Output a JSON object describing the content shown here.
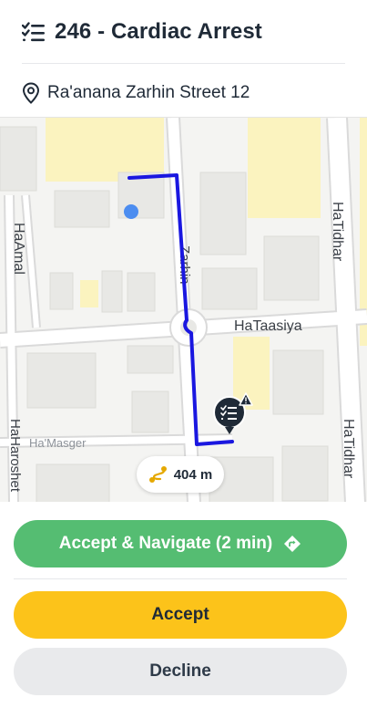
{
  "incident": {
    "title": "246 - Cardiac Arrest",
    "address": "Ra'anana Zarhin Street 12"
  },
  "map": {
    "streets": {
      "zarhin": "Zarhin",
      "hataasiya": "HaTaasiya",
      "hatidhar_top": "HaTidhar",
      "hatidhar_bottom": "HaTidhar",
      "haamal": "HaAmal",
      "hamasger": "Ha'Masger",
      "haharoshet": "HaHaroshet"
    },
    "distance": "404 m",
    "colors": {
      "route": "#1a17e0",
      "user_dot": "#4c8df0",
      "marker": "#1f2a37"
    }
  },
  "actions": {
    "navigate_label": "Accept & Navigate (2 min)",
    "accept_label": "Accept",
    "decline_label": "Decline"
  },
  "colors": {
    "navigate": "#55bd72",
    "accept": "#fcc31a",
    "decline": "#e9eaec"
  }
}
